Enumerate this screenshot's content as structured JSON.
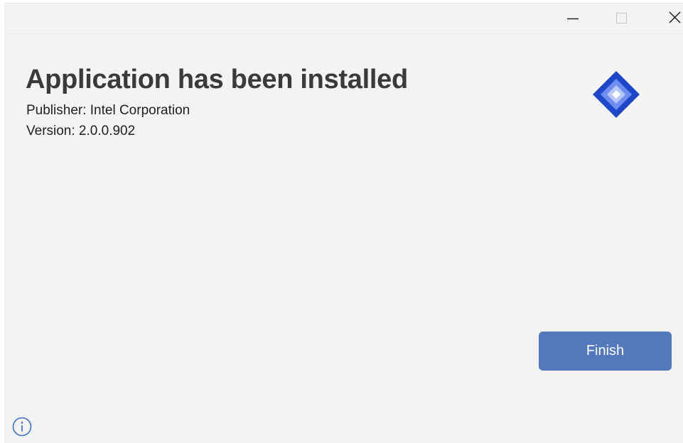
{
  "window": {
    "caption_buttons": {
      "minimize_icon": "minimize-icon",
      "maximize_icon": "maximize-icon",
      "close_icon": "close-icon"
    }
  },
  "content": {
    "title": "Application has been installed",
    "publisher": "Publisher: Intel Corporation",
    "version": "Version: 2.0.0.902"
  },
  "logo": {
    "icon": "diamond-app-logo-icon",
    "colors": [
      "#1f48c9",
      "#6e8df0",
      "#b7c7f7",
      "#ffffff"
    ]
  },
  "actions": {
    "finish_label": "Finish",
    "finish_color": "#5478bc"
  },
  "footer": {
    "info_icon": "info-icon",
    "info_color": "#3f6fc4"
  }
}
